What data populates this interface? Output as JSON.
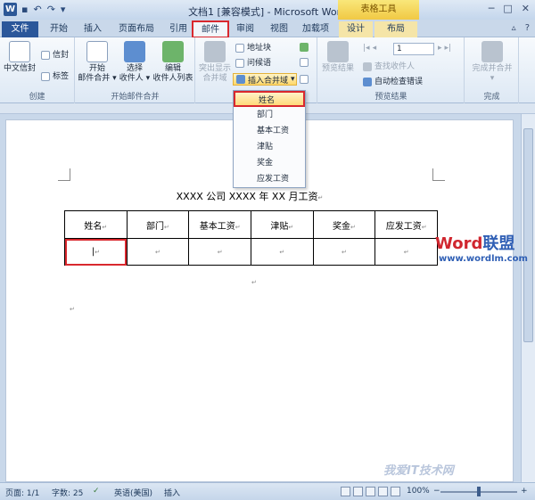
{
  "window": {
    "app_icon": "W",
    "title": "文档1 [兼容模式] - Microsoft Word",
    "context_tab": "表格工具",
    "qat": [
      "save-icon",
      "undo-icon",
      "redo-icon",
      "customize-icon"
    ],
    "controls": [
      "─",
      "□",
      "✕"
    ]
  },
  "tabs": {
    "file": "文件",
    "home": "开始",
    "insert": "插入",
    "layout": "页面布局",
    "references": "引用",
    "mailings": "邮件",
    "review": "审阅",
    "view": "视图",
    "addins": "加载项",
    "design": "设计",
    "table_layout": "布局"
  },
  "ribbon": {
    "create": {
      "label": "创建",
      "chinese_envelope": "中文信封",
      "envelopes": "信封",
      "labels": "标签"
    },
    "start_merge": {
      "label": "开始邮件合并",
      "start_line1": "开始",
      "start_line2": "邮件合并 ▾",
      "select_line1": "选择",
      "select_line2": "收件人 ▾",
      "edit_line1": "编辑",
      "edit_line2": "收件人列表"
    },
    "fields": {
      "highlight_line1": "突出显示",
      "highlight_line2": "合并域",
      "address_block": "地址块",
      "greeting_line": "问候语",
      "insert_merge_field": "插入合并域",
      "arrow": "▾"
    },
    "preview": {
      "label": "预览结果",
      "preview_results": "预览结果",
      "page_value": "1",
      "find_recipient": "查找收件人",
      "auto_check": "自动检查错误"
    },
    "finish": {
      "label": "完成",
      "finish_merge": "完成并合并",
      "arrow": "▾"
    }
  },
  "dropdown": {
    "items": [
      "姓名",
      "部门",
      "基本工资",
      "津贴",
      "奖金",
      "应发工资"
    ]
  },
  "document": {
    "title": "XXXX 公司 XXXX 年 XX 月工资",
    "headers": [
      "姓名",
      "部门",
      "基本工资",
      "津贴",
      "奖金",
      "应发工资"
    ],
    "para_mark": "↵"
  },
  "watermark": {
    "word": "Word",
    "cn": "联盟",
    "url": "www.wordlm.com",
    "bottom": "我爱IT技术网"
  },
  "statusbar": {
    "page": "页面: 1/1",
    "words": "字数: 25",
    "language": "英语(美国)",
    "mode": "插入",
    "zoom": "100%",
    "minus": "−",
    "plus": "+"
  },
  "colors": {
    "accent": "#2b579a",
    "highlight_red": "#d9282e",
    "context_yellow": "#f0c63f"
  }
}
